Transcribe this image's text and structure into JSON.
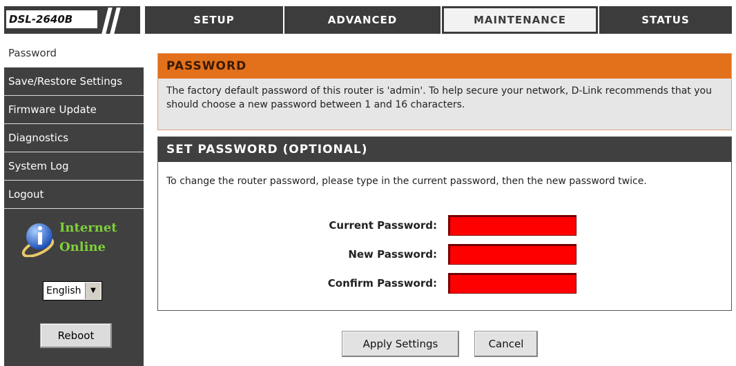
{
  "header": {
    "model": "DSL-2640B",
    "tabs": [
      {
        "label": "SETUP"
      },
      {
        "label": "ADVANCED"
      },
      {
        "label": "MAINTENANCE",
        "active": true
      },
      {
        "label": "STATUS"
      }
    ]
  },
  "sidebar": {
    "items": [
      {
        "label": "Password",
        "active": true
      },
      {
        "label": "Save/Restore Settings"
      },
      {
        "label": "Firmware Update"
      },
      {
        "label": "Diagnostics"
      },
      {
        "label": "System Log"
      },
      {
        "label": "Logout"
      }
    ],
    "status": {
      "line1": "Internet",
      "line2": "Online",
      "icon": "info-globe-icon"
    },
    "language": "English",
    "reboot_label": "Reboot"
  },
  "password_panel": {
    "title": "PASSWORD",
    "description": "The factory default password of this router is 'admin'. To help secure your network, D-Link recommends that you should choose a new password between 1 and 16 characters."
  },
  "set_password_panel": {
    "title": "SET PASSWORD (OPTIONAL)",
    "intro": "To change the router password, please type in the current password, then the new password twice.",
    "fields": [
      {
        "label": "Current Password:",
        "value": ""
      },
      {
        "label": "New Password:",
        "value": ""
      },
      {
        "label": "Confirm Password:",
        "value": ""
      }
    ]
  },
  "actions": {
    "apply_label": "Apply Settings",
    "cancel_label": "Cancel"
  },
  "colors": {
    "nav_bg": "#3c3c3c",
    "accent_orange": "#e3701a",
    "field_highlight": "#ff0000",
    "online_green": "#7fd03a"
  }
}
